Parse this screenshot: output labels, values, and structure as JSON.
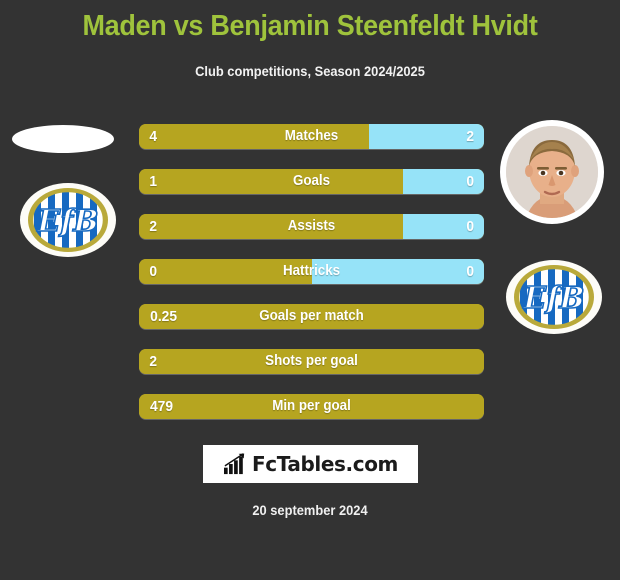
{
  "header": {
    "title": "Maden vs Benjamin Steenfeldt Hvidt",
    "subtitle": "Club competitions, Season 2024/2025"
  },
  "colors": {
    "background": "#333333",
    "title_green": "#9fc33c",
    "home_gold": "#b6a520",
    "away_blue": "#96e3f8",
    "text_white": "#ffffff"
  },
  "home": {
    "photo": "missing-player-photo-placeholder",
    "club_badge": "efb-club-badge",
    "badge_text": "EfB"
  },
  "away": {
    "photo": "player-portrait-photo",
    "club_badge": "efb-club-badge",
    "badge_text": "EfB"
  },
  "chart_data": {
    "type": "bar",
    "title": "Maden vs Benjamin Steenfeldt Hvidt",
    "subtitle": "Club competitions, Season 2024/2025",
    "orientation": "horizontal-diverging",
    "categories": [
      "Matches",
      "Goals",
      "Assists",
      "Hattricks",
      "Goals per match",
      "Shots per goal",
      "Min per goal"
    ],
    "series": [
      {
        "name": "Maden",
        "color": "#b6a520",
        "values": [
          "4",
          "1",
          "2",
          "0",
          "0.25",
          "2",
          "479"
        ]
      },
      {
        "name": "Benjamin Steenfeldt Hvidt",
        "color": "#96e3f8",
        "values": [
          "2",
          "0",
          "0",
          "0",
          null,
          null,
          null
        ]
      }
    ],
    "fill_percent_home": [
      66.7,
      76.5,
      76.5,
      50,
      100,
      100,
      100
    ]
  },
  "rows": [
    {
      "label": "Matches",
      "home": "4",
      "away": "2",
      "home_pct": 66.7,
      "split": true
    },
    {
      "label": "Goals",
      "home": "1",
      "away": "0",
      "home_pct": 76.5,
      "split": true
    },
    {
      "label": "Assists",
      "home": "2",
      "away": "0",
      "home_pct": 76.5,
      "split": true
    },
    {
      "label": "Hattricks",
      "home": "0",
      "away": "0",
      "home_pct": 50,
      "split": true
    },
    {
      "label": "Goals per match",
      "home": "0.25",
      "away": "",
      "home_pct": 100,
      "split": false
    },
    {
      "label": "Shots per goal",
      "home": "2",
      "away": "",
      "home_pct": 100,
      "split": false
    },
    {
      "label": "Min per goal",
      "home": "479",
      "away": "",
      "home_pct": 100,
      "split": false
    }
  ],
  "footer": {
    "logo_text": "FcTables.com",
    "logo_icon": "bar-chart-arrow-icon",
    "date": "20 september 2024"
  }
}
